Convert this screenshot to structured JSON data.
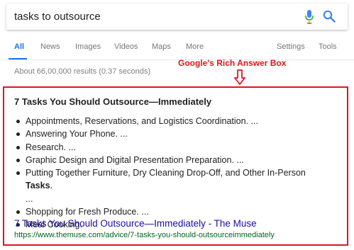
{
  "search": {
    "query": "tasks to outsource"
  },
  "tabs": [
    {
      "label": "All"
    },
    {
      "label": "News"
    },
    {
      "label": "Images"
    },
    {
      "label": "Videos"
    },
    {
      "label": "Maps"
    },
    {
      "label": "More"
    },
    {
      "label": "Settings"
    },
    {
      "label": "Tools"
    }
  ],
  "result_stats": "About 66,00,000 results (0.37 seconds)",
  "annotation": {
    "label": "Google's Rich Answer Box",
    "color": "#e0151b"
  },
  "answer_box": {
    "title": "7 Tasks You Should Outsource—Immediately",
    "items": [
      "Appointments, Reservations, and Logistics Coordination. ...",
      "Answering Your Phone. ...",
      "Research. ...",
      "Graphic Design and Digital Presentation Preparation. ...",
      "Putting Together Furniture, Dry Cleaning Drop-Off, and Other In-Person",
      "Shopping for Fresh Produce. ...",
      "Meal Cooking."
    ],
    "item_bold_suffix": "Tasks",
    "item_continuation": "...",
    "link_title": "7 Tasks You Should Outsource—Immediately - The Muse",
    "link_url": "https://www.themuse.com/advice/7-tasks-you-should-outsourceimmediately"
  },
  "icons": {
    "mic": "microphone-icon",
    "search": "search-icon",
    "arrow": "arrow-down-icon"
  },
  "colors": {
    "accent": "#1a73e8",
    "annotation": "#e0151b",
    "link": "#1a0dab",
    "url": "#006621"
  }
}
